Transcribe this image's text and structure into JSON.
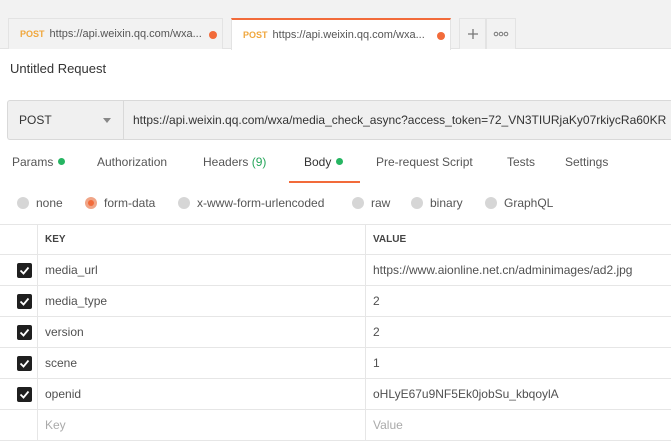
{
  "tabs": [
    {
      "method": "POST",
      "url": "https://api.weixin.qq.com/wxa..."
    },
    {
      "method": "POST",
      "url": "https://api.weixin.qq.com/wxa..."
    }
  ],
  "tab_actions": {
    "new_tab": "+",
    "more": "ooo"
  },
  "request": {
    "title": "Untitled Request",
    "method": "POST",
    "url": "https://api.weixin.qq.com/wxa/media_check_async?access_token=72_VN3TIURjaKy07rkiycRa60KR"
  },
  "subtabs": {
    "params": "Params",
    "authorization": "Authorization",
    "headers": "Headers",
    "headers_count": "(9)",
    "body": "Body",
    "prerequest": "Pre-request Script",
    "tests": "Tests",
    "settings": "Settings"
  },
  "body_types": {
    "none": "none",
    "form_data": "form-data",
    "urlencoded": "x-www-form-urlencoded",
    "raw": "raw",
    "binary": "binary",
    "graphql": "GraphQL",
    "selected": "form-data"
  },
  "table": {
    "header": {
      "key": "KEY",
      "value": "VALUE"
    },
    "rows": [
      {
        "key": "media_url",
        "value": "https://www.aionline.net.cn/adminimages/ad2.jpg",
        "checked": true
      },
      {
        "key": "media_type",
        "value": "2",
        "checked": true
      },
      {
        "key": "version",
        "value": "2",
        "checked": true
      },
      {
        "key": "scene",
        "value": "1",
        "checked": true
      },
      {
        "key": "openid",
        "value": "oHLyE67u9NF5Ek0jobSu_kbqoylA",
        "checked": true
      }
    ],
    "placeholder": {
      "key": "Key",
      "value": "Value"
    }
  },
  "colors": {
    "accent": "#f26b3a",
    "method_orange": "#f0a73c",
    "green_indicator": "#26b562"
  }
}
